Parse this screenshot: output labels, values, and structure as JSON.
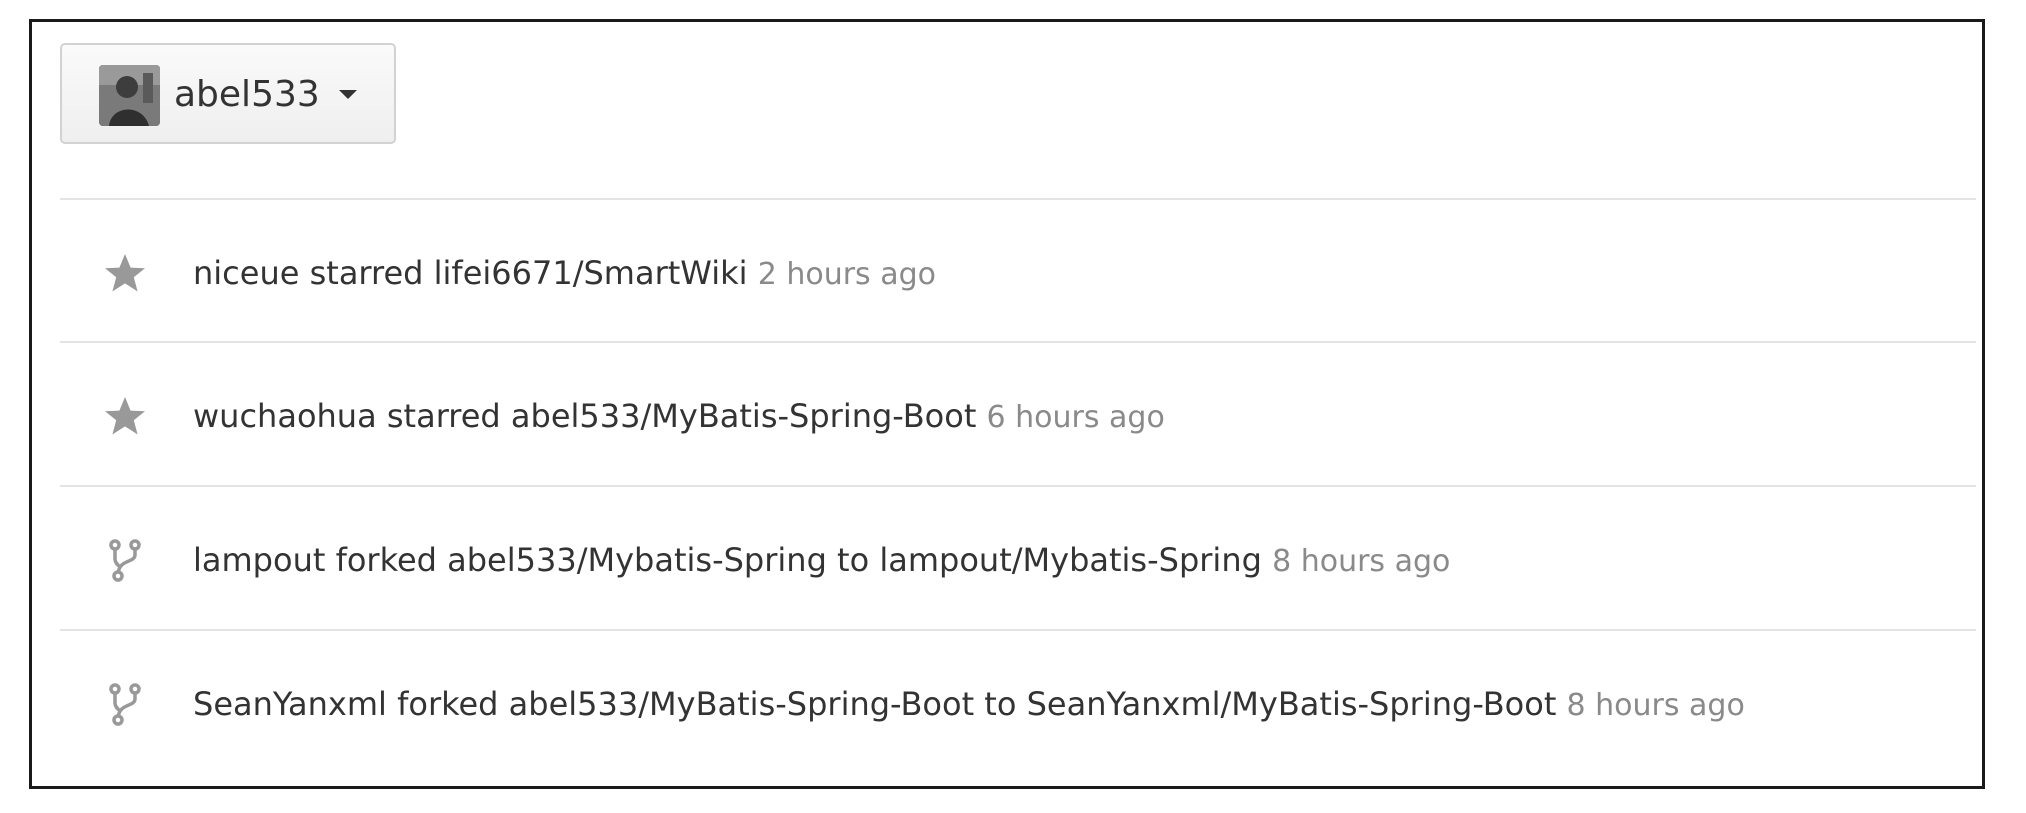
{
  "context_switcher": {
    "username": "abel533"
  },
  "news_feed": [
    {
      "icon": "star-icon",
      "actor": "niceue",
      "action": "starred",
      "repo": "lifei6671/SmartWiki",
      "connector": "",
      "target": "",
      "time": "2 hours ago"
    },
    {
      "icon": "star-icon",
      "actor": "wuchaohua",
      "action": "starred",
      "repo": "abel533/MyBatis-Spring-Boot",
      "connector": "",
      "target": "",
      "time": "6 hours ago"
    },
    {
      "icon": "repo-forked-icon",
      "actor": "lampout",
      "action": "forked",
      "repo": "abel533/Mybatis-Spring",
      "connector": "to",
      "target": "lampout/Mybatis-Spring",
      "time": "8 hours ago"
    },
    {
      "icon": "repo-forked-icon",
      "actor": "SeanYanxml",
      "action": "forked",
      "repo": "abel533/MyBatis-Spring-Boot",
      "connector": "to",
      "target": "SeanYanxml/MyBatis-Spring-Boot",
      "time": "8 hours ago"
    }
  ],
  "colors": {
    "text": "#333333",
    "muted": "#8a8a8a",
    "icon": "#999999",
    "divider": "#e4e4e4",
    "frame_border": "#1a1a1a"
  }
}
